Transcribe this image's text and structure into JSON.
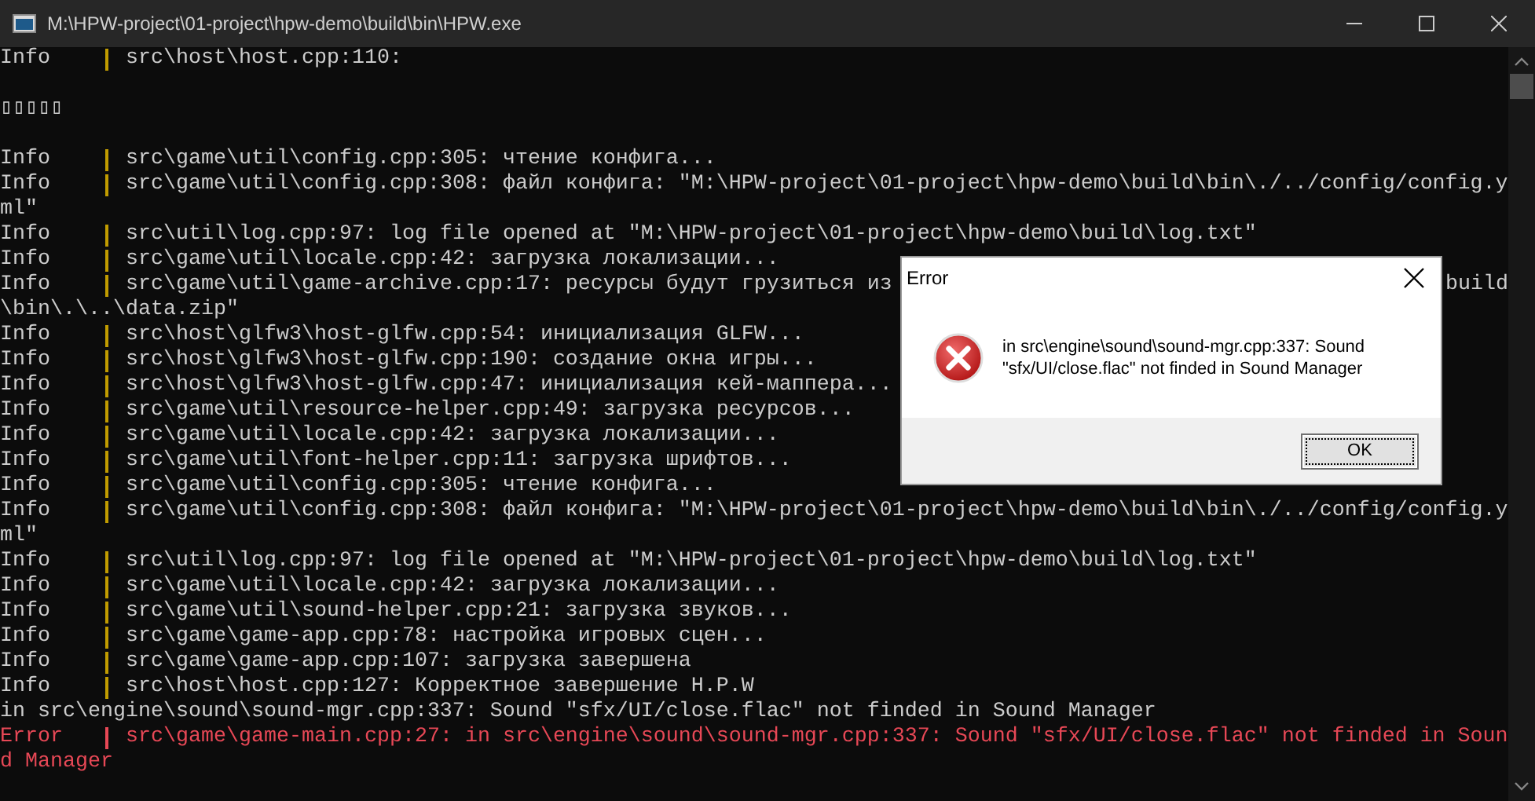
{
  "window": {
    "title": "M:\\HPW-project\\01-project\\hpw-demo\\build\\bin\\HPW.exe"
  },
  "console": {
    "lines": [
      {
        "kind": "entry",
        "tag": "Info",
        "error": false,
        "message": "src\\host\\host.cpp:110:"
      },
      {
        "kind": "blank"
      },
      {
        "kind": "text",
        "error": false,
        "text": "▯▯▯▯▯"
      },
      {
        "kind": "blank"
      },
      {
        "kind": "entry",
        "tag": "Info",
        "error": false,
        "message": "src\\game\\util\\config.cpp:305: чтение конфига..."
      },
      {
        "kind": "entry",
        "tag": "Info",
        "error": false,
        "message": "src\\game\\util\\config.cpp:308: файл конфига: \"M:\\HPW-project\\01-project\\hpw-demo\\build\\bin\\./../config/config.y"
      },
      {
        "kind": "text",
        "error": false,
        "text": "ml\""
      },
      {
        "kind": "entry",
        "tag": "Info",
        "error": false,
        "message": "src\\util\\log.cpp:97: log file opened at \"M:\\HPW-project\\01-project\\hpw-demo\\build\\log.txt\""
      },
      {
        "kind": "entry",
        "tag": "Info",
        "error": false,
        "message": "src\\game\\util\\locale.cpp:42: загрузка локализации..."
      },
      {
        "kind": "entry",
        "tag": "Info",
        "error": false,
        "message": "src\\game\\util\\game-archive.cpp:17: ресурсы будут грузиться из",
        "tail": "build"
      },
      {
        "kind": "text",
        "error": false,
        "text": "\\bin\\.\\..\\data.zip\""
      },
      {
        "kind": "entry",
        "tag": "Info",
        "error": false,
        "message": "src\\host\\glfw3\\host-glfw.cpp:54: инициализация GLFW..."
      },
      {
        "kind": "entry",
        "tag": "Info",
        "error": false,
        "message": "src\\host\\glfw3\\host-glfw.cpp:190: создание окна игры..."
      },
      {
        "kind": "entry",
        "tag": "Info",
        "error": false,
        "message": "src\\host\\glfw3\\host-glfw.cpp:47: инициализация кей-маппера..."
      },
      {
        "kind": "entry",
        "tag": "Info",
        "error": false,
        "message": "src\\game\\util\\resource-helper.cpp:49: загрузка ресурсов..."
      },
      {
        "kind": "entry",
        "tag": "Info",
        "error": false,
        "message": "src\\game\\util\\locale.cpp:42: загрузка локализации..."
      },
      {
        "kind": "entry",
        "tag": "Info",
        "error": false,
        "message": "src\\game\\util\\font-helper.cpp:11: загрузка шрифтов..."
      },
      {
        "kind": "entry",
        "tag": "Info",
        "error": false,
        "message": "src\\game\\util\\config.cpp:305: чтение конфига..."
      },
      {
        "kind": "entry",
        "tag": "Info",
        "error": false,
        "message": "src\\game\\util\\config.cpp:308: файл конфига: \"M:\\HPW-project\\01-project\\hpw-demo\\build\\bin\\./../config/config.y"
      },
      {
        "kind": "text",
        "error": false,
        "text": "ml\""
      },
      {
        "kind": "entry",
        "tag": "Info",
        "error": false,
        "message": "src\\util\\log.cpp:97: log file opened at \"M:\\HPW-project\\01-project\\hpw-demo\\build\\log.txt\""
      },
      {
        "kind": "entry",
        "tag": "Info",
        "error": false,
        "message": "src\\game\\util\\locale.cpp:42: загрузка локализации..."
      },
      {
        "kind": "entry",
        "tag": "Info",
        "error": false,
        "message": "src\\game\\util\\sound-helper.cpp:21: загрузка звуков..."
      },
      {
        "kind": "entry",
        "tag": "Info",
        "error": false,
        "message": "src\\game\\game-app.cpp:78: настройка игровых сцен..."
      },
      {
        "kind": "entry",
        "tag": "Info",
        "error": false,
        "message": "src\\game\\game-app.cpp:107: загрузка завершена"
      },
      {
        "kind": "entry",
        "tag": "Info",
        "error": false,
        "message": "src\\host\\host.cpp:127: Корректное завершение H.P.W"
      },
      {
        "kind": "text",
        "error": false,
        "text": "in src\\engine\\sound\\sound-mgr.cpp:337: Sound \"sfx/UI/close.flac\" not finded in Sound Manager"
      },
      {
        "kind": "entry",
        "tag": "Error",
        "error": true,
        "message": "src\\game\\game-main.cpp:27: in src\\engine\\sound\\sound-mgr.cpp:337: Sound \"sfx/UI/close.flac\" not finded in Soun"
      },
      {
        "kind": "text",
        "error": true,
        "text": "d Manager"
      }
    ]
  },
  "dialog": {
    "title": "Error",
    "message": "in src\\engine\\sound\\sound-mgr.cpp:337: Sound \"sfx/UI/close.flac\" not finded in Sound Manager",
    "button": "OK"
  }
}
